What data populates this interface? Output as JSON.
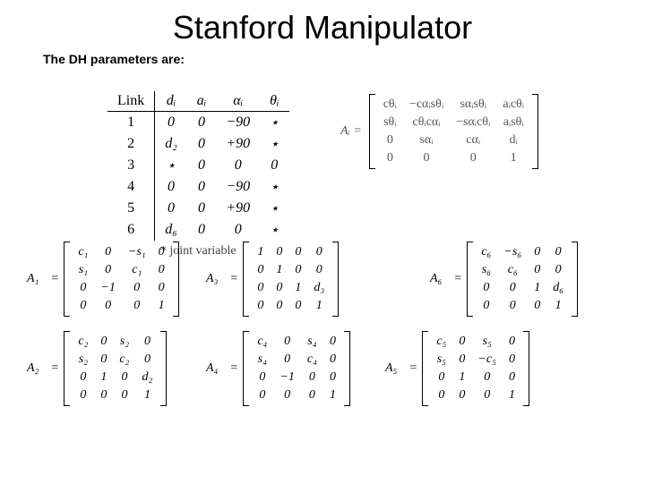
{
  "title": "Stanford Manipulator",
  "subheading": "The DH parameters are:",
  "dh_table": {
    "headers": [
      "Link",
      "dᵢ",
      "aᵢ",
      "αᵢ",
      "θᵢ"
    ],
    "rows": [
      [
        "1",
        "0",
        "0",
        "−90",
        "⋆"
      ],
      [
        "2",
        "d₂",
        "0",
        "+90",
        "⋆"
      ],
      [
        "3",
        "⋆",
        "0",
        "0",
        "0"
      ],
      [
        "4",
        "0",
        "0",
        "−90",
        "⋆"
      ],
      [
        "5",
        "0",
        "0",
        "+90",
        "⋆"
      ],
      [
        "6",
        "d₆",
        "0",
        "0",
        "⋆"
      ]
    ],
    "footnote": "* joint variable"
  },
  "generic_matrix": {
    "lhs": "Aᵢ =",
    "rows": [
      [
        "cθᵢ",
        "−cαᵢsθᵢ",
        "sαᵢsθᵢ",
        "aᵢcθᵢ"
      ],
      [
        "sθᵢ",
        "cθᵢcαᵢ",
        "−sαᵢcθᵢ",
        "aᵢsθᵢ"
      ],
      [
        "0",
        "sαᵢ",
        "cαᵢ",
        "dᵢ"
      ],
      [
        "0",
        "0",
        "0",
        "1"
      ]
    ]
  },
  "matrices": {
    "A1": {
      "lhs": "A₁",
      "rows": [
        [
          "c₁",
          "0",
          "−s₁",
          "0"
        ],
        [
          "s₁",
          "0",
          "c₁",
          "0"
        ],
        [
          "0",
          "−1",
          "0",
          "0"
        ],
        [
          "0",
          "0",
          "0",
          "1"
        ]
      ]
    },
    "A2": {
      "lhs": "A₂",
      "rows": [
        [
          "c₂",
          "0",
          "s₂",
          "0"
        ],
        [
          "s₂",
          "0",
          "c₂",
          "0"
        ],
        [
          "0",
          "1",
          "0",
          "d₂"
        ],
        [
          "0",
          "0",
          "0",
          "1"
        ]
      ]
    },
    "A3": {
      "lhs": "A₃",
      "rows": [
        [
          "1",
          "0",
          "0",
          "0"
        ],
        [
          "0",
          "1",
          "0",
          "0"
        ],
        [
          "0",
          "0",
          "1",
          "d₃"
        ],
        [
          "0",
          "0",
          "0",
          "1"
        ]
      ]
    },
    "A4": {
      "lhs": "A₄",
      "rows": [
        [
          "c₄",
          "0",
          "s₄",
          "0"
        ],
        [
          "s₄",
          "0",
          "c₄",
          "0"
        ],
        [
          "0",
          "−1",
          "0",
          "0"
        ],
        [
          "0",
          "0",
          "0",
          "1"
        ]
      ]
    },
    "A5": {
      "lhs": "A₅",
      "rows": [
        [
          "c₅",
          "0",
          "s₅",
          "0"
        ],
        [
          "s₅",
          "0",
          "−c₅",
          "0"
        ],
        [
          "0",
          "1",
          "0",
          "0"
        ],
        [
          "0",
          "0",
          "0",
          "1"
        ]
      ]
    },
    "A6": {
      "lhs": "A₆",
      "rows": [
        [
          "c₆",
          "−s₆",
          "0",
          "0"
        ],
        [
          "s₆",
          "c₆",
          "0",
          "0"
        ],
        [
          "0",
          "0",
          "1",
          "d₆"
        ],
        [
          "0",
          "0",
          "0",
          "1"
        ]
      ]
    }
  }
}
